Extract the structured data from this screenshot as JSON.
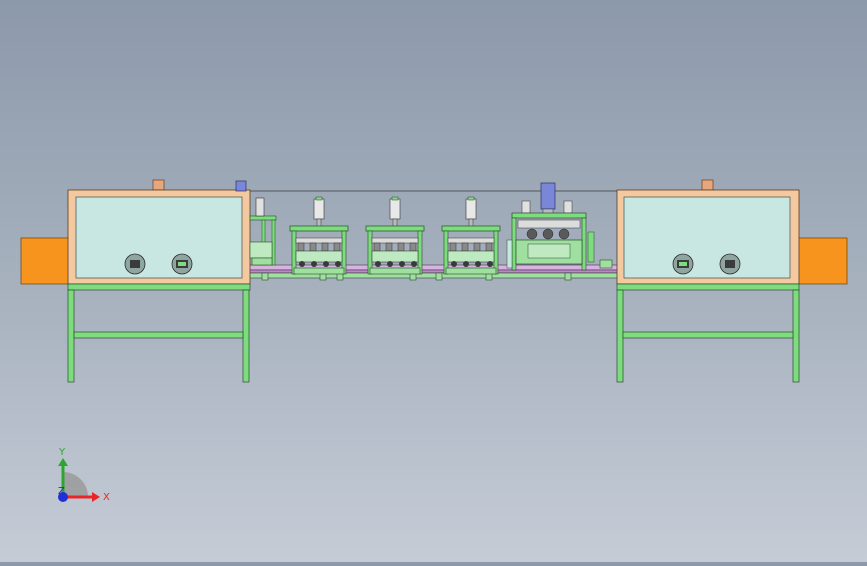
{
  "viewport": {
    "view": "front",
    "background": {
      "top": "#8c99aa",
      "bottom": "#c5ccd6"
    }
  },
  "colors": {
    "frame_green": "#7ddc7e",
    "frame_outline": "#2c4a2c",
    "panel_fill": "#c8e6e2",
    "cabinet_trim": "#f4c9a0",
    "conveyor_orange": "#f7941d",
    "nozzle_peach": "#e6a77c",
    "cylinder_blue": "#7a86d8",
    "rail_purple": "#b98ac5"
  },
  "model": {
    "left_cabinet": {
      "name": "left-cabinet",
      "indicators": 2
    },
    "right_cabinet": {
      "name": "right-cabinet",
      "indicators": 2
    },
    "stations": [
      {
        "name": "station-1",
        "cylinders": 1
      },
      {
        "name": "station-2",
        "cylinders": 1
      },
      {
        "name": "station-3",
        "cylinders": 1
      },
      {
        "name": "station-4",
        "cylinders": 1
      },
      {
        "name": "station-5-main",
        "cylinders": 1
      }
    ]
  },
  "triad": {
    "x_label": "X",
    "y_label": "Y",
    "z_label": "Z",
    "x_color": "#e8262a",
    "y_color": "#2fa531",
    "z_color": "#2030d8"
  }
}
